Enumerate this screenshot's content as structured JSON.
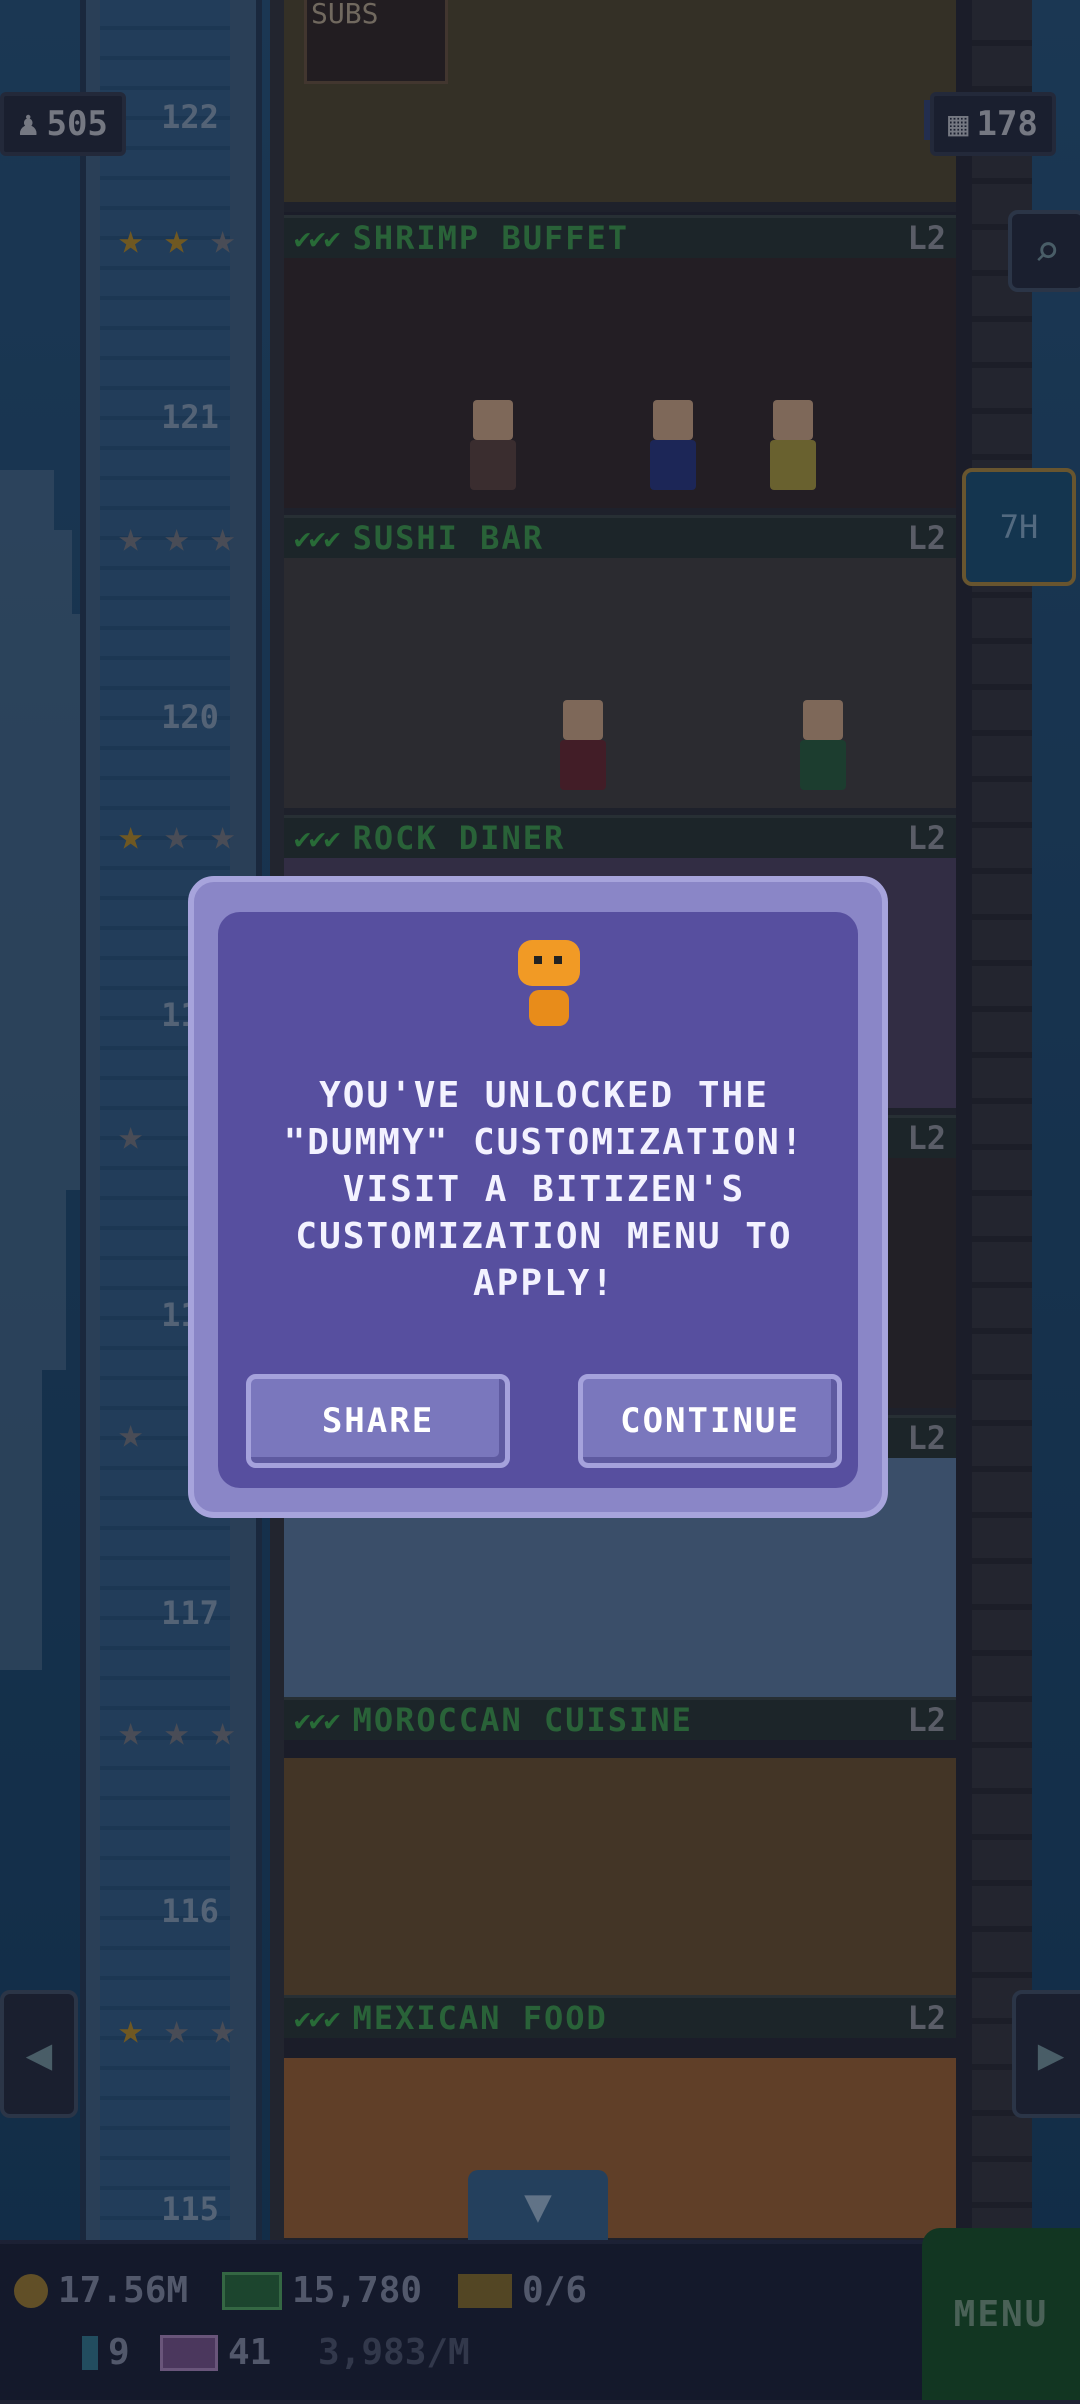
{
  "top_counters": {
    "population": "505",
    "floors": "178"
  },
  "floor_labels": [
    "122",
    "121",
    "120",
    "119",
    "118",
    "117",
    "116",
    "115"
  ],
  "floors": [
    {
      "name": "SHRIMP BUFFET",
      "level": "L2",
      "checks": "✔✔✔",
      "stars_gold": 2
    },
    {
      "name": "SUSHI BAR",
      "level": "L2",
      "checks": "✔✔✔",
      "stars_gold": 0
    },
    {
      "name": "ROCK DINER",
      "level": "L2",
      "checks": "✔✔✔",
      "stars_gold": 1
    },
    {
      "name": "MOROCCAN CUISINE",
      "level": "L2",
      "checks": "✔✔✔",
      "stars_gold": 0
    },
    {
      "name": "MEXICAN FOOD",
      "level": "L2",
      "checks": "✔✔✔",
      "stars_gold": 1
    }
  ],
  "top_shop_sign": "SUBS",
  "side_right": {
    "time_label": "7H",
    "search_icon": "magnifier-icon",
    "home_icon": "elevator-home-icon"
  },
  "dialog": {
    "message": "YOU'VE UNLOCKED THE\n\"DUMMY\" CUSTOMIZATION!\nVISIT A BITIZEN'S\nCUSTOMIZATION MENU TO\nAPPLY!",
    "share_label": "SHARE",
    "continue_label": "CONTINUE"
  },
  "bottom_bar": {
    "coins": "17.56M",
    "bux": "15,780",
    "tickets": "0/6",
    "gems": "9",
    "tbox": "41",
    "rate": "3,983/M",
    "menu_label": "MENU"
  },
  "colors": {
    "accent_green": "#48b54c",
    "dialog_bg": "#574f9f",
    "gold_star": "#d5a021"
  }
}
